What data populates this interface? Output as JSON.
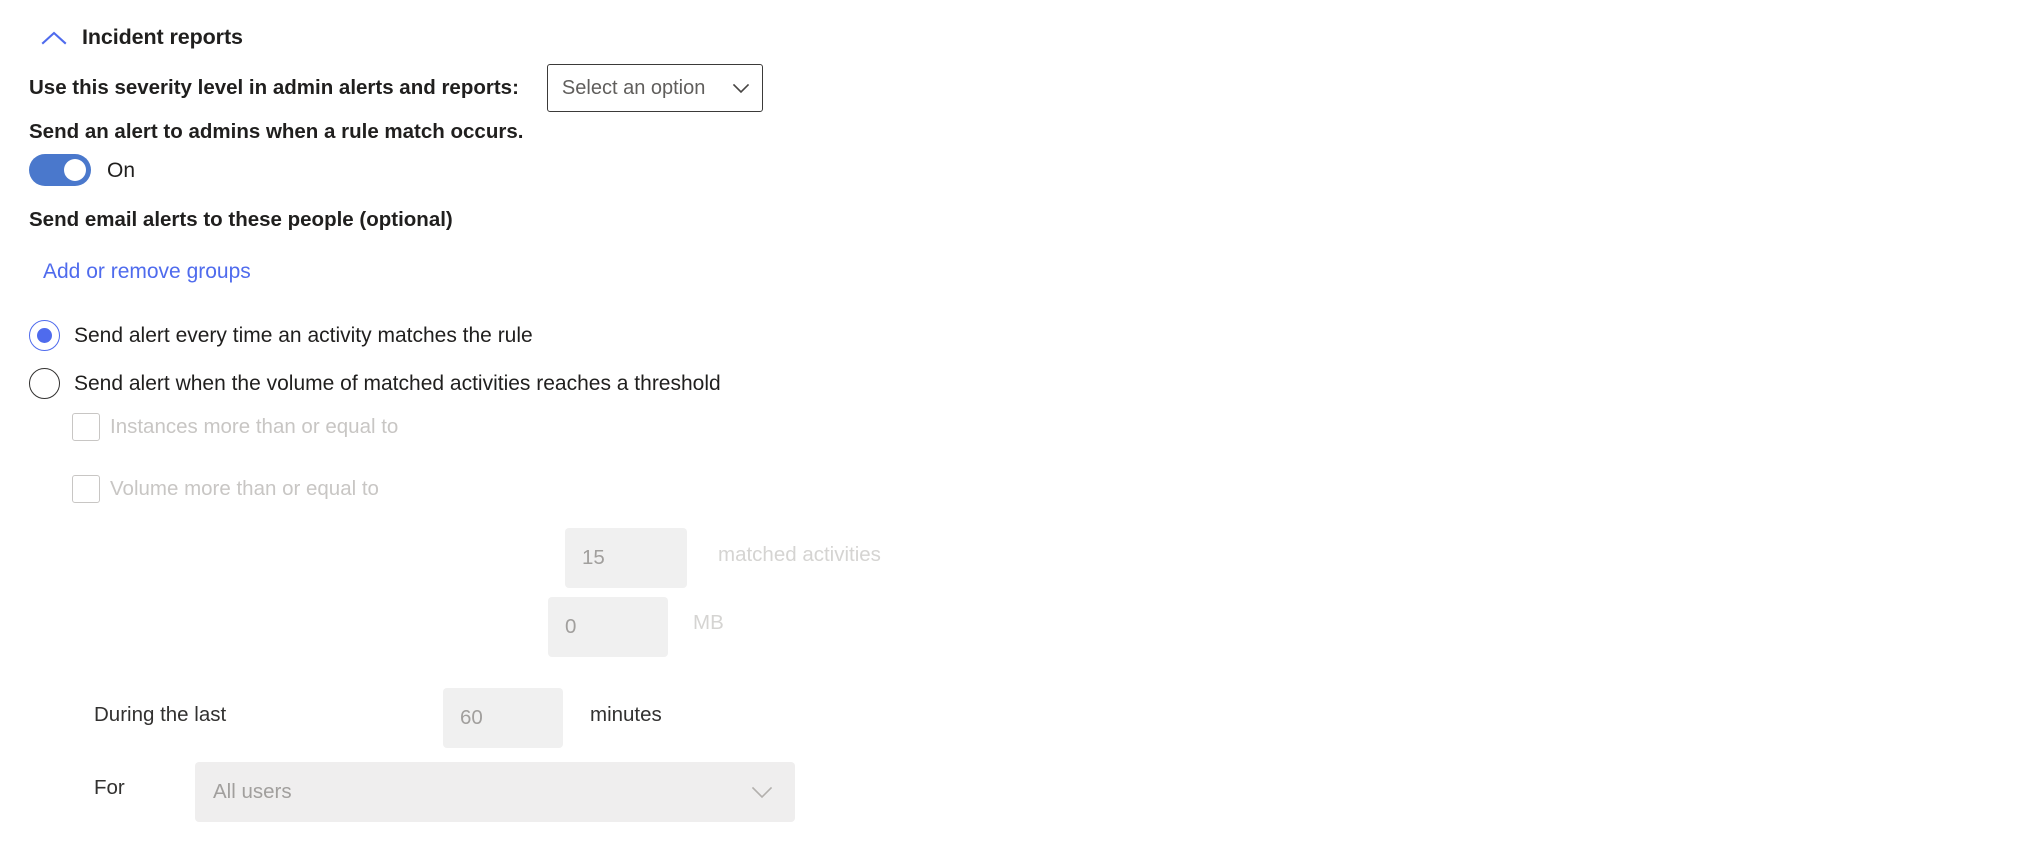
{
  "section": {
    "title": "Incident reports",
    "collapse_icon": "chevron-up-icon",
    "accent_color": "#4f6bed"
  },
  "severity": {
    "label": "Use this severity level in admin alerts and reports:",
    "select_value": "Select an option",
    "caret_icon": "chevron-down-icon"
  },
  "admin_alert": {
    "label": "Send an alert to admins when a rule match occurs.",
    "toggle_state": "On",
    "toggle_on": true,
    "toggle_color": "#4a78cc"
  },
  "email_alerts": {
    "label": "Send email alerts to these people (optional)",
    "link_label": "Add or remove groups",
    "link_color": "#4f6bed"
  },
  "alert_mode": {
    "options": [
      {
        "label": "Send alert every time an activity matches the rule",
        "checked": true
      },
      {
        "label": "Send alert when the volume of matched activities reaches a threshold",
        "checked": false
      }
    ]
  },
  "threshold": {
    "instances": {
      "checkbox_label": "Instances more than or equal to",
      "value": "15",
      "unit": "matched activities",
      "checked": false,
      "disabled": true
    },
    "volume": {
      "checkbox_label": "Volume more than or equal to",
      "value": "0",
      "unit": "MB",
      "checked": false,
      "disabled": true
    },
    "duration": {
      "prefix_label": "During the last",
      "value": "60",
      "unit": "minutes"
    },
    "scope": {
      "prefix_label": "For",
      "select_value": "All users",
      "caret_icon": "chevron-down-icon"
    }
  }
}
